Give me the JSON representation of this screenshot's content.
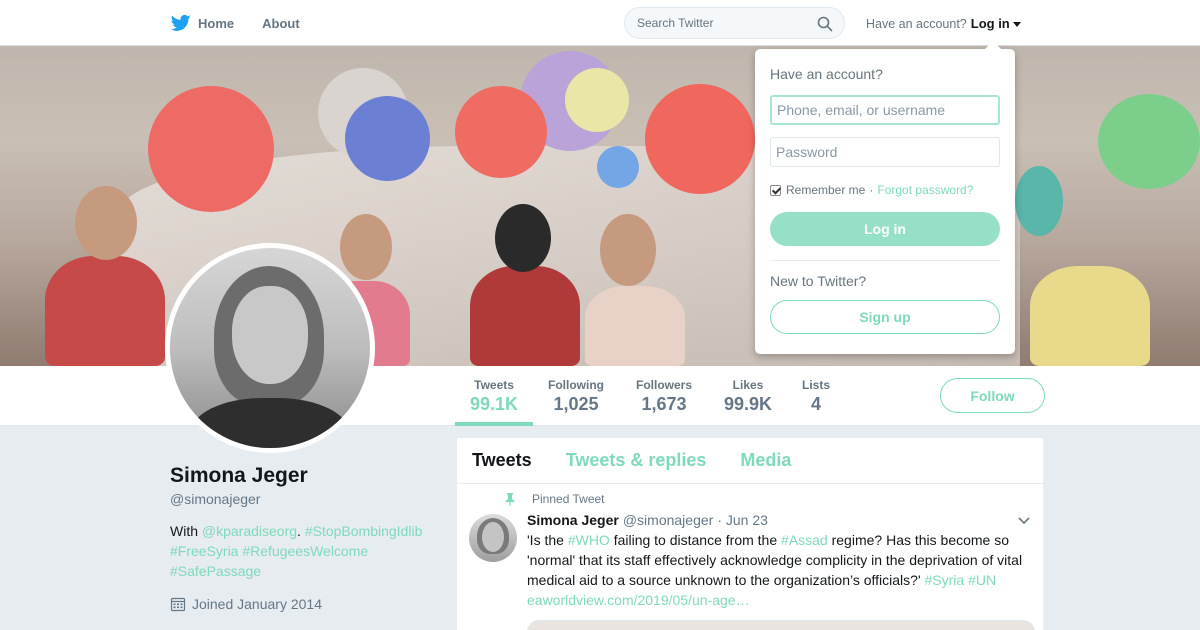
{
  "nav": {
    "logo_icon": "twitter-bird-icon",
    "home_label": "Home",
    "about_label": "About",
    "search_placeholder": "Search Twitter",
    "have_account": "Have an account?",
    "login_label": "Log in"
  },
  "colors": {
    "accent": "#7fd9bc",
    "bird": "#1da1f2"
  },
  "profile": {
    "name": "Simona Jeger",
    "handle": "@simonajeger",
    "bio_prefix": "With ",
    "bio_mention": "@kparadiseorg",
    "bio_sep": ". ",
    "hashtags": [
      "#StopBombingIdlib",
      "#FreeSyria",
      "#RefugeesWelcome",
      "#SafePassage"
    ],
    "joined": "Joined January 2014"
  },
  "stats": [
    {
      "label": "Tweets",
      "value": "99.1K"
    },
    {
      "label": "Following",
      "value": "1,025"
    },
    {
      "label": "Followers",
      "value": "1,673"
    },
    {
      "label": "Likes",
      "value": "99.9K"
    },
    {
      "label": "Lists",
      "value": "4"
    }
  ],
  "follow_label": "Follow",
  "timeline": {
    "tabs": [
      "Tweets",
      "Tweets & replies",
      "Media"
    ],
    "pinned_label": "Pinned Tweet",
    "tweet": {
      "author": "Simona Jeger",
      "handle": "@simonajeger",
      "date": "· Jun 23",
      "text_1": "'Is the ",
      "tag_who": "#WHO",
      "text_2": " failing to distance from the ",
      "tag_assad": "#Assad",
      "text_3": " regime? Has this become so 'normal' that its staff effectively acknowledge complicity in the deprivation of vital medical aid to a source unknown to the organization’s officials?' ",
      "tag_syria": "#Syria",
      "tag_un": "#UN",
      "link": "eaworldview.com/2019/05/un-age…"
    }
  },
  "login_dropdown": {
    "title": "Have an account?",
    "username_placeholder": "Phone, email, or username",
    "password_placeholder": "Password",
    "remember_label": "Remember me",
    "separator": "·",
    "forgot_label": "Forgot password?",
    "login_button": "Log in",
    "new_label": "New to Twitter?",
    "signup_button": "Sign up"
  }
}
